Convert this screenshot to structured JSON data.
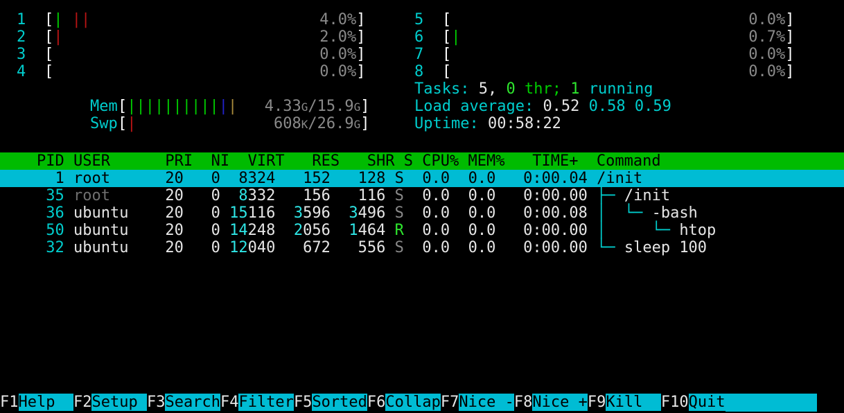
{
  "app": {
    "name": "htop",
    "colors": {
      "accent_cyan": "#00cdcd",
      "header_green": "#00bb00",
      "selected_row": "#00bcd4",
      "bar_green": "#00cd00",
      "bar_red": "#b81414",
      "bar_blue": "#2222cc",
      "bar_tan": "#a98b3c",
      "text_gray": "#8a8a8a",
      "text_white": "#e6e6e6",
      "background": "#000000"
    }
  },
  "cpu_meters_left": [
    {
      "id": "1",
      "value": "4.0%",
      "bars": [
        {
          "glyph": "|",
          "color": "green"
        },
        {
          "glyph": " ",
          "color": "none"
        },
        {
          "glyph": "|",
          "color": "red"
        },
        {
          "glyph": "|",
          "color": "red"
        }
      ]
    },
    {
      "id": "2",
      "value": "2.0%",
      "bars": [
        {
          "glyph": "|",
          "color": "red"
        }
      ]
    },
    {
      "id": "3",
      "value": "0.0%",
      "bars": []
    },
    {
      "id": "4",
      "value": "0.0%",
      "bars": []
    }
  ],
  "cpu_meters_right": [
    {
      "id": "5",
      "value": "0.0%",
      "bars": []
    },
    {
      "id": "6",
      "value": "0.7%",
      "bars": [
        {
          "glyph": "|",
          "color": "green"
        }
      ]
    },
    {
      "id": "7",
      "value": "0.0%",
      "bars": []
    },
    {
      "id": "8",
      "value": "0.0%",
      "bars": []
    }
  ],
  "mem_meter": {
    "label": "Mem",
    "value_used": "4.33",
    "unit_used": "G",
    "separator": "/",
    "value_total": "15.9",
    "unit_total": "G",
    "bars": [
      {
        "glyph": "|",
        "color": "green"
      },
      {
        "glyph": "|",
        "color": "green"
      },
      {
        "glyph": "|",
        "color": "green"
      },
      {
        "glyph": "|",
        "color": "green"
      },
      {
        "glyph": "|",
        "color": "green"
      },
      {
        "glyph": "|",
        "color": "green"
      },
      {
        "glyph": "|",
        "color": "green"
      },
      {
        "glyph": "|",
        "color": "green"
      },
      {
        "glyph": "|",
        "color": "green"
      },
      {
        "glyph": "|",
        "color": "green"
      },
      {
        "glyph": "|",
        "color": "blue"
      },
      {
        "glyph": "|",
        "color": "tan"
      }
    ]
  },
  "swap_meter": {
    "label": "Swp",
    "value_used": "608",
    "unit_used": "K",
    "separator": "/",
    "value_total": "26.9",
    "unit_total": "G",
    "bars": [
      {
        "glyph": "|",
        "color": "red"
      }
    ]
  },
  "summary": {
    "tasks_label": "Tasks:",
    "tasks_count": "5,",
    "threads_count": "0",
    "threads_word": "thr;",
    "running_count": "1",
    "running_word": "running",
    "load_label": "Load average:",
    "load_1": "0.52",
    "load_5": "0.58",
    "load_15": "0.59",
    "uptime_label": "Uptime:",
    "uptime_value": "00:58:22"
  },
  "table": {
    "columns": [
      "PID",
      "USER",
      "PRI",
      "NI",
      "VIRT",
      "RES",
      "SHR",
      "S",
      "CPU%",
      "MEM%",
      "TIME+",
      "Command"
    ],
    "header_line": "    PID USER      PRI  NI  VIRT   RES   SHR S CPU% MEM%   TIME+  Command",
    "rows": [
      {
        "selected": true,
        "pid": "1",
        "user": "root",
        "user_dim": false,
        "pri": "20",
        "ni": "0",
        "virt_hi": "",
        "virt_lo": "8324",
        "res_hi": "",
        "res_lo": "152",
        "shr_hi": "",
        "shr_lo": "128",
        "state": "S",
        "state_running": false,
        "cpu": "0.0",
        "mem": "0.0",
        "time": "0:00.04",
        "tree": "",
        "command": "/init"
      },
      {
        "selected": false,
        "pid": "35",
        "user": "root",
        "user_dim": true,
        "pri": "20",
        "ni": "0",
        "virt_hi": "8",
        "virt_lo": "332",
        "res_hi": "",
        "res_lo": "156",
        "shr_hi": "",
        "shr_lo": "116",
        "state": "S",
        "state_running": false,
        "cpu": "0.0",
        "mem": "0.0",
        "time": "0:00.00",
        "tree": "├─ ",
        "command": "/init"
      },
      {
        "selected": false,
        "pid": "36",
        "user": "ubuntu",
        "user_dim": false,
        "pri": "20",
        "ni": "0",
        "virt_hi": "15",
        "virt_lo": "116",
        "res_hi": "3",
        "res_lo": "596",
        "shr_hi": "3",
        "shr_lo": "496",
        "state": "S",
        "state_running": false,
        "cpu": "0.0",
        "mem": "0.0",
        "time": "0:00.08",
        "tree": "│  └─ ",
        "command": "-bash"
      },
      {
        "selected": false,
        "pid": "50",
        "user": "ubuntu",
        "user_dim": false,
        "pri": "20",
        "ni": "0",
        "virt_hi": "14",
        "virt_lo": "248",
        "res_hi": "2",
        "res_lo": "056",
        "shr_hi": "1",
        "shr_lo": "464",
        "state": "R",
        "state_running": true,
        "cpu": "0.0",
        "mem": "0.0",
        "time": "0:00.00",
        "tree": "│     └─ ",
        "command": "htop"
      },
      {
        "selected": false,
        "pid": "32",
        "user": "ubuntu",
        "user_dim": false,
        "pri": "20",
        "ni": "0",
        "virt_hi": "12",
        "virt_lo": "040",
        "res_hi": "",
        "res_lo": "672",
        "shr_hi": "",
        "shr_lo": "556",
        "state": "S",
        "state_running": false,
        "cpu": "0.0",
        "mem": "0.0",
        "time": "0:00.00",
        "tree": "└─ ",
        "command": "sleep 100"
      }
    ]
  },
  "function_keys": [
    {
      "key": "F1",
      "label": "Help  "
    },
    {
      "key": "F2",
      "label": "Setup "
    },
    {
      "key": "F3",
      "label": "Search"
    },
    {
      "key": "F4",
      "label": "Filter"
    },
    {
      "key": "F5",
      "label": "Sorted"
    },
    {
      "key": "F6",
      "label": "Collap"
    },
    {
      "key": "F7",
      "label": "Nice -"
    },
    {
      "key": "F8",
      "label": "Nice +"
    },
    {
      "key": "F9",
      "label": "Kill  "
    },
    {
      "key": "F10",
      "label": "Quit"
    }
  ]
}
